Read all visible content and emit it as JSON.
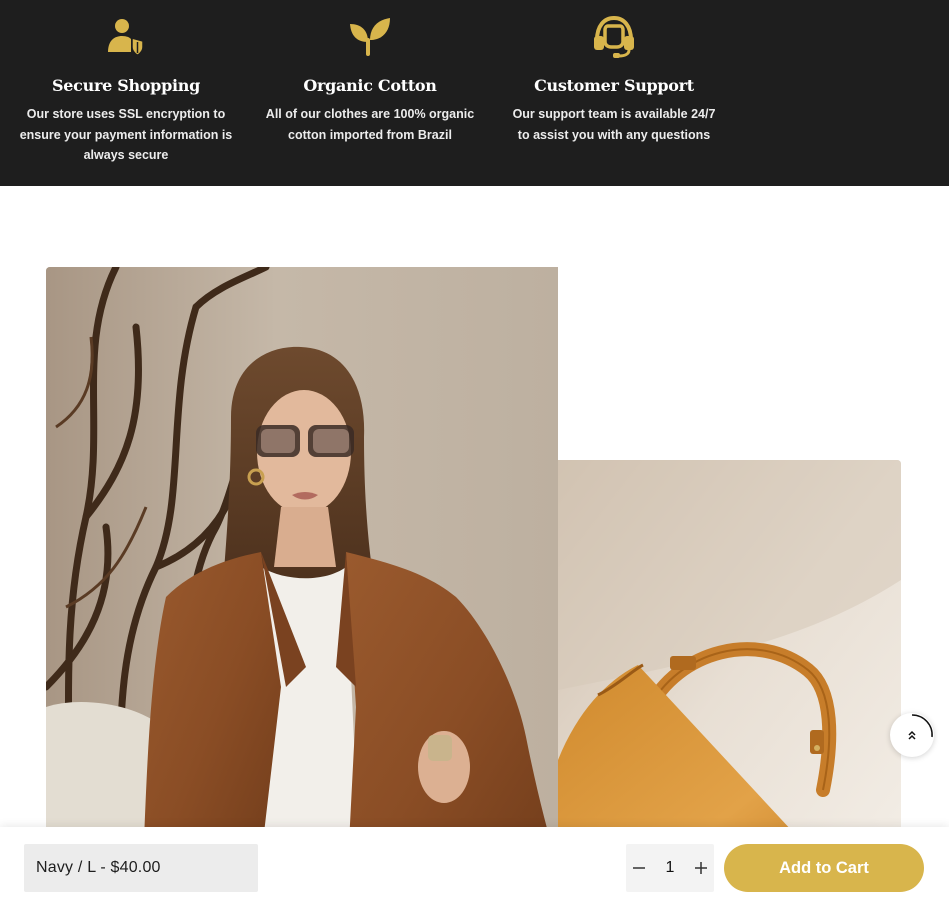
{
  "features": [
    {
      "icon": "user-shield-icon",
      "title": "Secure Shopping",
      "desc_lines": [
        "Our store uses SSL encryption to",
        "ensure your payment information is",
        "always secure"
      ]
    },
    {
      "icon": "sprout-icon",
      "title": "Organic Cotton",
      "desc_lines": [
        "All of our clothes are 100% organic",
        "cotton imported from Brazil"
      ]
    },
    {
      "icon": "headset-icon",
      "title": "Customer Support",
      "desc_lines": [
        "Our support team is available 24/7",
        "to assist you with any questions"
      ]
    }
  ],
  "colors": {
    "accent": "#d8b54c",
    "dark_band": "#1e1e1e"
  },
  "sticky_bar": {
    "variant_label": "Navy / L - $40.00",
    "quantity": "1",
    "add_to_cart_label": "Add to Cart"
  }
}
